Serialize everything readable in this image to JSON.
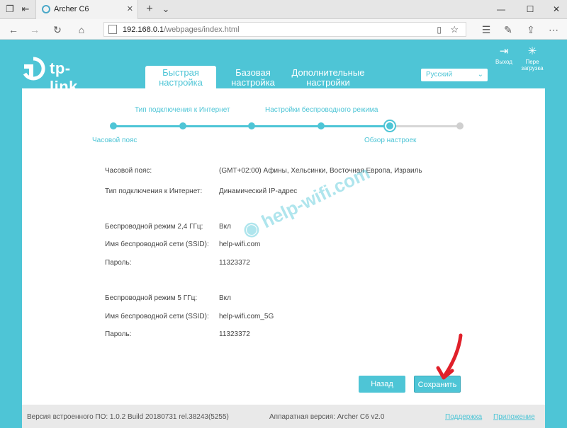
{
  "browser": {
    "tab_title": "Archer C6",
    "url_host": "192.168.0.1",
    "url_path": "/webpages/index.html"
  },
  "router": {
    "logo_text": "tp-link",
    "tabs": [
      {
        "line1": "Быстрая",
        "line2": "настройка"
      },
      {
        "line1": "Базовая",
        "line2": "настройка"
      },
      {
        "line1": "Дополнительные",
        "line2": "настройки"
      }
    ],
    "language": "Русский",
    "logout_label": "Выход",
    "reboot_line1": "Пере",
    "reboot_line2": "загрузка"
  },
  "wizard": {
    "steps_top": [
      "Тип подключения к Интернет",
      "Настройки беспроводного режима"
    ],
    "steps_bottom": [
      "Часовой пояс",
      "Обзор настроек"
    ]
  },
  "summary": {
    "rows": [
      {
        "label": "Часовой пояс:",
        "value": "(GMT+02:00) Афины, Хельсинки, Восточная Европа, Израиль"
      },
      {
        "label": "Тип подключения к Интернет:",
        "value": "Динамический IP-адрес"
      },
      {
        "label": "Беспроводной режим 2,4 ГГц:",
        "value": "Вкл"
      },
      {
        "label": "Имя беспроводной сети (SSID):",
        "value": "help-wifi.com"
      },
      {
        "label": "Пароль:",
        "value": "11323372"
      },
      {
        "label": "Беспроводной режим 5 ГГц:",
        "value": "Вкл"
      },
      {
        "label": "Имя беспроводной сети (SSID):",
        "value": "help-wifi.com_5G"
      },
      {
        "label": "Пароль:",
        "value": "11323372"
      }
    ]
  },
  "buttons": {
    "back": "Назад",
    "save": "Сохранить"
  },
  "footer": {
    "firmware": "Версия встроенного ПО: 1.0.2 Build 20180731 rel.38243(5255)",
    "hardware": "Аппаратная версия: Archer C6 v2.0",
    "support": "Поддержка",
    "app": "Приложение"
  },
  "watermark": "help-wifi.com",
  "colors": {
    "accent": "#4ec5d6",
    "arrow": "#e0202a"
  }
}
